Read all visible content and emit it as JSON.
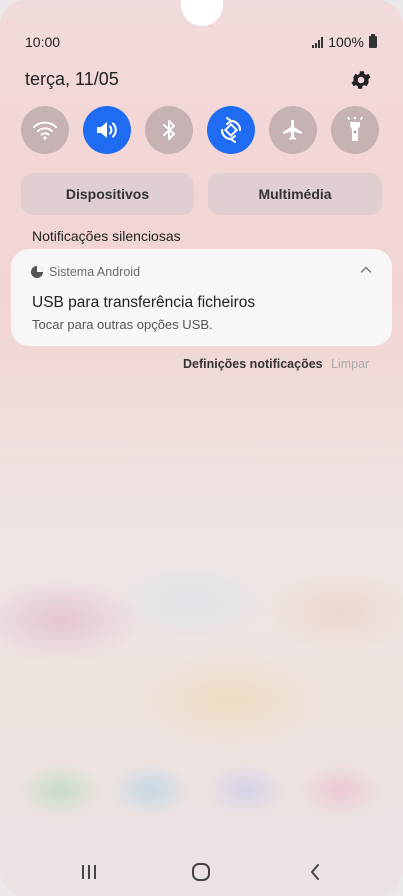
{
  "status": {
    "time": "10:00",
    "battery": "100%",
    "icons": [
      "signal-icon",
      "battery-icon"
    ]
  },
  "panel": {
    "date": "terça, 11/05",
    "settings_icon": "gear-icon"
  },
  "quick_settings": [
    {
      "name": "Wi-Fi",
      "icon": "wifi-icon",
      "state": "off"
    },
    {
      "name": "Som",
      "icon": "sound-icon",
      "state": "on"
    },
    {
      "name": "Bluetooth",
      "icon": "bluetooth-icon",
      "state": "off"
    },
    {
      "name": "Rodar automaticamente",
      "icon": "auto-rotate-icon",
      "state": "on"
    },
    {
      "name": "Modo de voo",
      "icon": "airplane-icon",
      "state": "off"
    },
    {
      "name": "Lanterna",
      "icon": "flashlight-icon",
      "state": "off"
    }
  ],
  "buttons": {
    "devices": "Dispositivos",
    "media": "Multimédia"
  },
  "notifications": {
    "section_title": "Notificações silenciosas",
    "card": {
      "app_name": "Sistema Android",
      "title": "USB para transferência ficheiros",
      "text": "Tocar para outras opções USB."
    },
    "settings_label": "Definições notificações",
    "clear_label": "Limpar"
  },
  "colors": {
    "accent": "#1f6cf2",
    "tile_off": "#a09496"
  },
  "navbar": [
    "recents-icon",
    "home-icon",
    "back-icon"
  ]
}
